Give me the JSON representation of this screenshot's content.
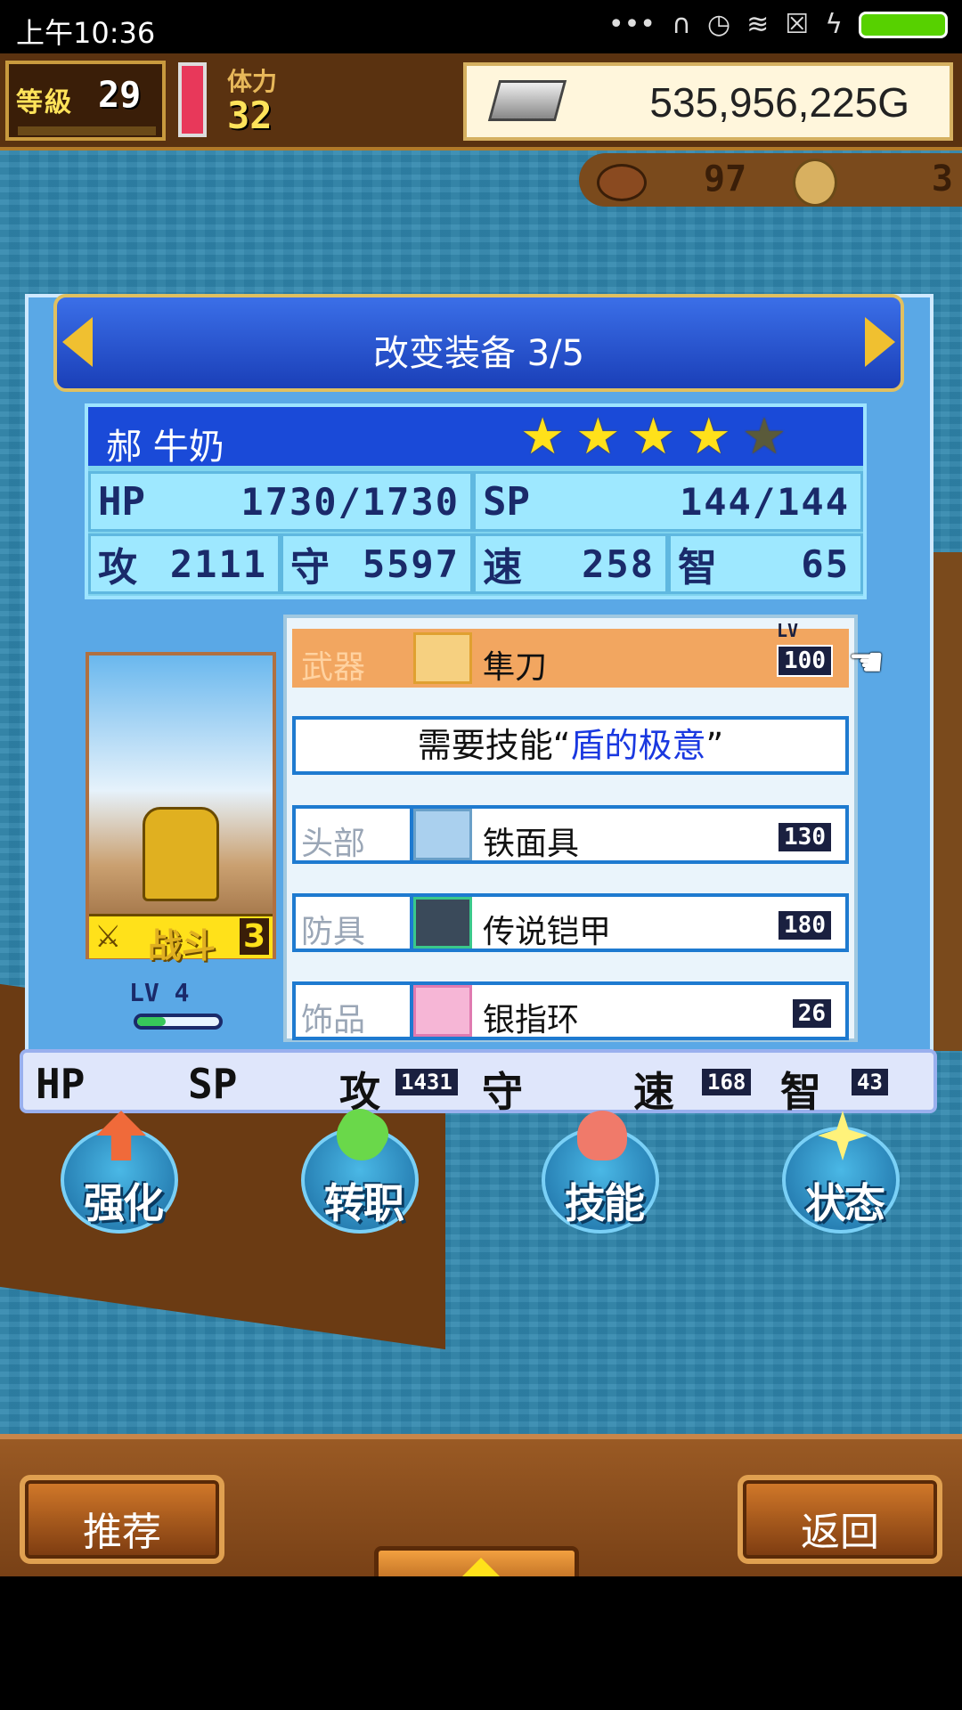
{
  "status_bar": {
    "time": "上午10:36",
    "icons": [
      "more-icon",
      "headset-icon",
      "alarm-icon",
      "wifi-icon",
      "sim-icon",
      "charging-icon",
      "battery-icon"
    ]
  },
  "hud": {
    "level_label": "等級",
    "level_value": "29",
    "stamina_label": "体力",
    "stamina_value": "32",
    "gold": "535,956,225G",
    "resource1": "97",
    "resource2": "3"
  },
  "panel": {
    "title": "改变装备 3/5",
    "character": {
      "name": "郝 牛奶",
      "stars_total": 5,
      "stars_filled": 4,
      "hp_label": "HP",
      "hp_value": "1730/1730",
      "sp_label": "SP",
      "sp_value": "144/144",
      "atk_label": "攻",
      "atk_value": "2111",
      "def_label": "守",
      "def_value": "5597",
      "spd_label": "速",
      "spd_value": "258",
      "int_label": "智",
      "int_value": "65",
      "battle_label": "战斗",
      "battle_count": "3",
      "lv_label": "LV",
      "lv_value": "4",
      "exp_fraction": 0.35
    },
    "equipment": {
      "lv_tag": "LV",
      "weapon": {
        "slot": "武器",
        "name": "隼刀",
        "lv": "100"
      },
      "skill_requirement": {
        "prefix": "需要技能“",
        "skill": "盾的极意",
        "suffix": "”"
      },
      "head": {
        "slot": "头部",
        "name": "铁面具",
        "lv": "130"
      },
      "armor": {
        "slot": "防具",
        "name": "传说铠甲",
        "lv": "180"
      },
      "accessory": {
        "slot": "饰品",
        "name": "银指环",
        "lv": "26"
      }
    },
    "bonus": {
      "hp_label": "HP",
      "sp_label": "SP",
      "atk_label": "攻",
      "atk_value": "1431",
      "def_label": "守",
      "spd_label": "速",
      "spd_value": "168",
      "int_label": "智",
      "int_value": "43"
    }
  },
  "actions": {
    "enhance": "强化",
    "job_change": "转职",
    "skill": "技能",
    "status": "状态"
  },
  "bottom": {
    "recommend": "推荐",
    "back": "返回"
  }
}
